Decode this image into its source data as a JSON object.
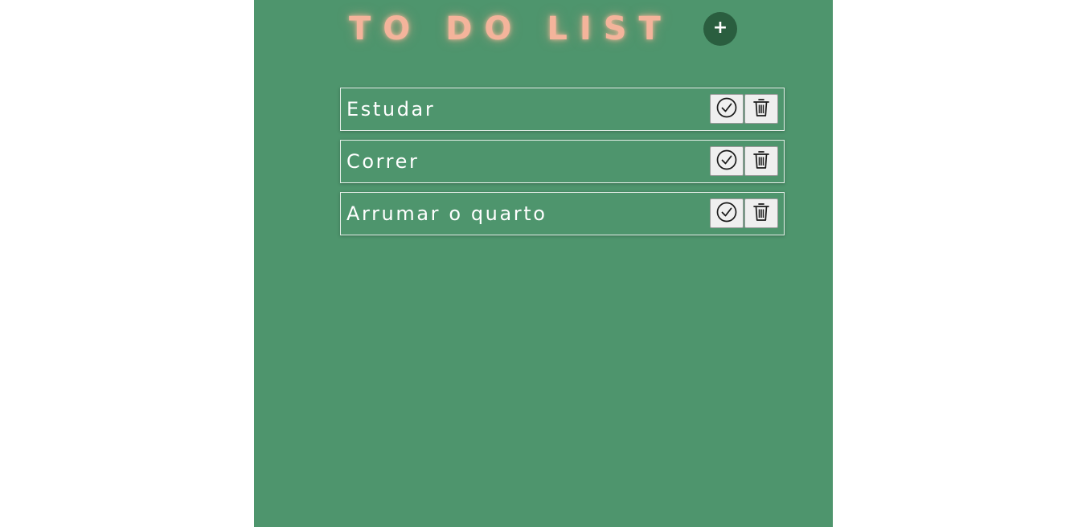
{
  "app": {
    "title": "TO DO LIST",
    "add_button_label": "+"
  },
  "tasks": [
    {
      "text": "Estudar",
      "complete_icon": "check-circle-icon",
      "delete_icon": "trash-icon"
    },
    {
      "text": "Correr",
      "complete_icon": "check-circle-icon",
      "delete_icon": "trash-icon"
    },
    {
      "text": "Arrumar o quarto",
      "complete_icon": "check-circle-icon",
      "delete_icon": "trash-icon"
    }
  ],
  "colors": {
    "panel_background": "#4e956d",
    "page_background": "#ffffff",
    "title_color": "#f4b49b",
    "add_button_background": "#2a5e3f",
    "task_text_color": "#ffffff",
    "action_button_background": "#efefef"
  }
}
